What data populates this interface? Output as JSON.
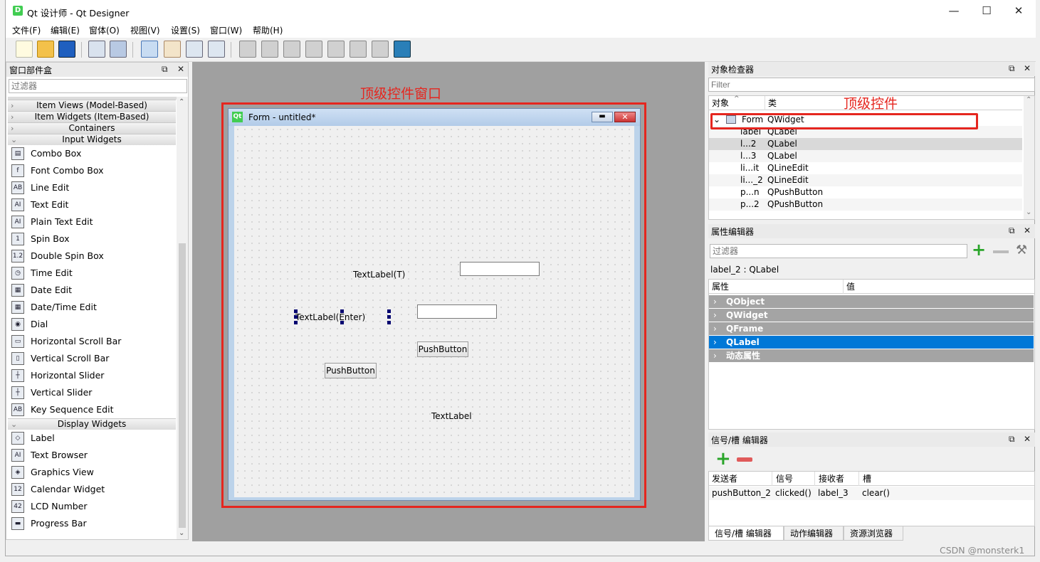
{
  "window": {
    "app_icon": "D",
    "title": "Qt 设计师 - Qt Designer",
    "minimize": "—",
    "maximize": "☐",
    "close": "✕"
  },
  "menu": [
    "文件(F)",
    "编辑(E)",
    "窗体(O)",
    "视图(V)",
    "设置(S)",
    "窗口(W)",
    "帮助(H)"
  ],
  "widget_box": {
    "title": "窗口部件盒",
    "filter_placeholder": "过滤器",
    "categories_top": [
      "Item Views (Model-Based)",
      "Item Widgets (Item-Based)",
      "Containers",
      "Input Widgets"
    ],
    "input_widgets": [
      {
        "label": "Combo Box",
        "icon": "combo-box-icon",
        "glyph": "▤"
      },
      {
        "label": "Font Combo Box",
        "icon": "font-combo-box-icon",
        "glyph": "f"
      },
      {
        "label": "Line Edit",
        "icon": "line-edit-icon",
        "glyph": "AB"
      },
      {
        "label": "Text Edit",
        "icon": "text-edit-icon",
        "glyph": "AI"
      },
      {
        "label": "Plain Text Edit",
        "icon": "plain-text-edit-icon",
        "glyph": "AI"
      },
      {
        "label": "Spin Box",
        "icon": "spin-box-icon",
        "glyph": "1"
      },
      {
        "label": "Double Spin Box",
        "icon": "double-spin-box-icon",
        "glyph": "1.2"
      },
      {
        "label": "Time Edit",
        "icon": "clock-icon",
        "glyph": "◷"
      },
      {
        "label": "Date Edit",
        "icon": "calendar-icon",
        "glyph": "▦"
      },
      {
        "label": "Date/Time Edit",
        "icon": "datetime-icon",
        "glyph": "▦"
      },
      {
        "label": "Dial",
        "icon": "dial-icon",
        "glyph": "◉"
      },
      {
        "label": "Horizontal Scroll Bar",
        "icon": "hscrollbar-icon",
        "glyph": "▭"
      },
      {
        "label": "Vertical Scroll Bar",
        "icon": "vscrollbar-icon",
        "glyph": "▯"
      },
      {
        "label": "Horizontal Slider",
        "icon": "hslider-icon",
        "glyph": "┼"
      },
      {
        "label": "Vertical Slider",
        "icon": "vslider-icon",
        "glyph": "┼"
      },
      {
        "label": "Key Sequence Edit",
        "icon": "key-sequence-icon",
        "glyph": "AB"
      }
    ],
    "display_category": "Display Widgets",
    "display_widgets": [
      {
        "label": "Label",
        "icon": "label-tag-icon",
        "glyph": "◇"
      },
      {
        "label": "Text Browser",
        "icon": "text-browser-icon",
        "glyph": "AI"
      },
      {
        "label": "Graphics View",
        "icon": "graphics-view-icon",
        "glyph": "◈"
      },
      {
        "label": "Calendar Widget",
        "icon": "calendar-widget-icon",
        "glyph": "12"
      },
      {
        "label": "LCD Number",
        "icon": "lcd-number-icon",
        "glyph": "42"
      },
      {
        "label": "Progress Bar",
        "icon": "progress-bar-icon",
        "glyph": "▬"
      }
    ]
  },
  "annotations": {
    "top_window": "顶级控件窗口",
    "top_widget": "顶级控件"
  },
  "form": {
    "title_icon": "Qt",
    "title": "Form - untitled*",
    "label_t": "TextLabel(T)",
    "label_enter": "TextLabel(Enter)",
    "push_button_1": "PushButton",
    "push_button_2": "PushButton",
    "label_3": "TextLabel"
  },
  "object_inspector": {
    "title": "对象检查器",
    "filter_placeholder": "Filter",
    "col_object": "对象",
    "col_class": "类",
    "rows": [
      {
        "object": "Form",
        "class": "QWidget"
      },
      {
        "object": "label",
        "class": "QLabel"
      },
      {
        "object": "l...2",
        "class": "QLabel"
      },
      {
        "object": "l...3",
        "class": "QLabel"
      },
      {
        "object": "li...it",
        "class": "QLineEdit"
      },
      {
        "object": "li..._2",
        "class": "QLineEdit"
      },
      {
        "object": "p...n",
        "class": "QPushButton"
      },
      {
        "object": "p...2",
        "class": "QPushButton"
      }
    ]
  },
  "property_editor": {
    "title": "属性编辑器",
    "filter_placeholder": "过滤器",
    "current": "label_2 : QLabel",
    "col_property": "属性",
    "col_value": "值",
    "groups": [
      "QObject",
      "QWidget",
      "QFrame",
      "QLabel",
      "动态属性"
    ]
  },
  "signal_slot_editor": {
    "title": "信号/槽 编辑器",
    "headers": [
      "发送者",
      "信号",
      "接收者",
      "槽"
    ],
    "rows": [
      {
        "sender": "pushButton_2",
        "signal": "clicked()",
        "receiver": "label_3",
        "slot": "clear()"
      }
    ],
    "tabs": [
      "信号/槽 编辑器",
      "动作编辑器",
      "资源浏览器"
    ]
  },
  "watermark": "CSDN @monsterk1",
  "colors": {
    "highlight": "#0078d7",
    "annotation": "#e5261f",
    "group_bg": "#a4a4a4"
  }
}
